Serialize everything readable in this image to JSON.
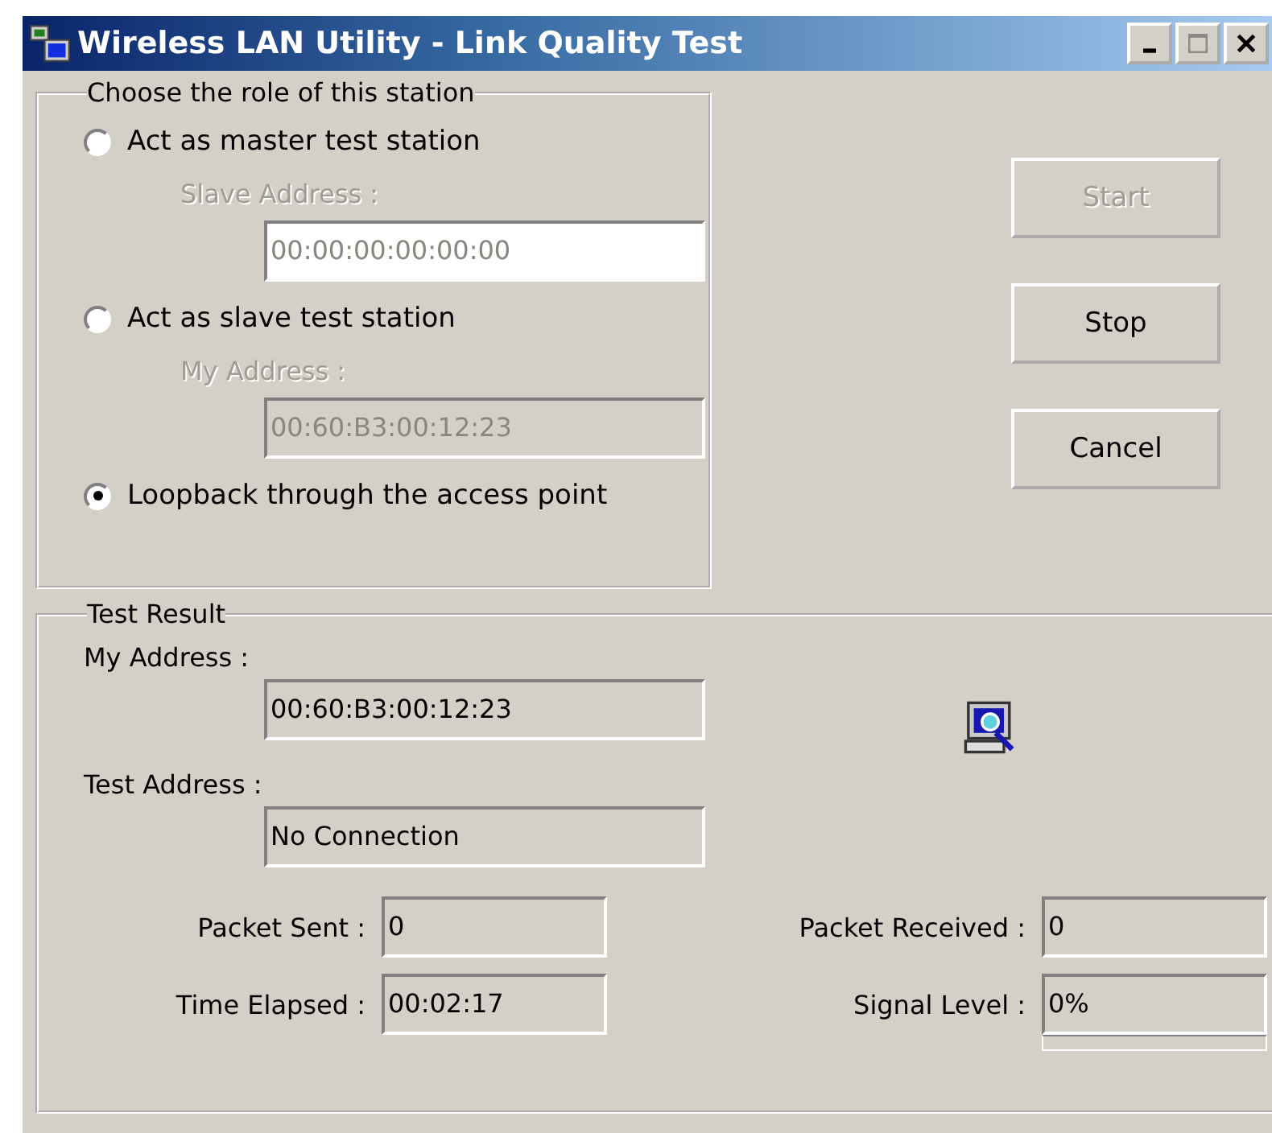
{
  "window": {
    "title": "Wireless LAN Utility - Link Quality Test"
  },
  "role_group": {
    "title": "Choose the role of this station",
    "items": [
      {
        "kind": "radio",
        "label": "Act as master test station",
        "selected": false
      },
      {
        "kind": "field",
        "label": "Slave Address :",
        "value": "00:00:00:00:00:00",
        "disabled": false
      },
      {
        "kind": "radio",
        "label": "Act as slave test station",
        "selected": false
      },
      {
        "kind": "field",
        "label": "My Address :",
        "value": "00:60:B3:00:12:23",
        "disabled": true
      },
      {
        "kind": "radio",
        "label": "Loopback through the access point",
        "selected": true
      }
    ]
  },
  "buttons": [
    {
      "label": "Start",
      "disabled": true
    },
    {
      "label": "Stop",
      "disabled": false
    },
    {
      "label": "Cancel",
      "disabled": false
    }
  ],
  "result_group": {
    "title": "Test Result",
    "fields": [
      {
        "label": "My Address :",
        "value": "00:60:B3:00:12:23"
      },
      {
        "label": "Test Address :",
        "value": "No Connection"
      }
    ],
    "stats": [
      {
        "label": "Packet Sent :",
        "value": "0"
      },
      {
        "label": "Packet Received :",
        "value": "0"
      },
      {
        "label": "Time Elapsed :",
        "value": "00:02:17"
      },
      {
        "label": "Signal Level :",
        "value": "0%",
        "level": 0
      }
    ]
  }
}
